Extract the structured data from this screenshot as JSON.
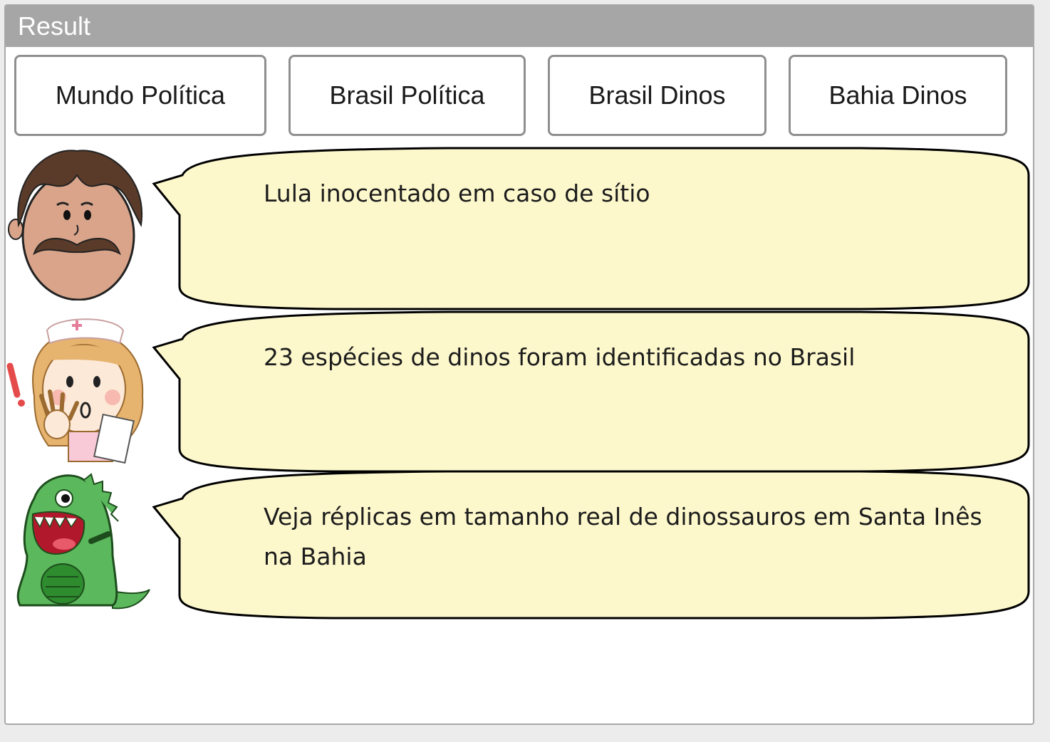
{
  "panel": {
    "title": "Result"
  },
  "buttons": [
    {
      "label": "Mundo Política"
    },
    {
      "label": "Brasil Política"
    },
    {
      "label": "Brasil Dinos"
    },
    {
      "label": "Bahia Dinos"
    }
  ],
  "messages": [
    {
      "avatar": "man-mustache-icon",
      "text": "Lula inocentado em caso de sítio"
    },
    {
      "avatar": "nurse-girl-icon",
      "text": "23 espécies de dinos foram identificadas no Brasil"
    },
    {
      "avatar": "green-dinosaur-icon",
      "text": "Veja réplicas em tamanho real de dinossauros em Santa Inês na Bahia"
    }
  ],
  "colors": {
    "header_bar": "#a6a6a6",
    "bubble_fill": "#fdf8cc",
    "bubble_stroke": "#000000",
    "button_border": "#8f8f8f"
  }
}
